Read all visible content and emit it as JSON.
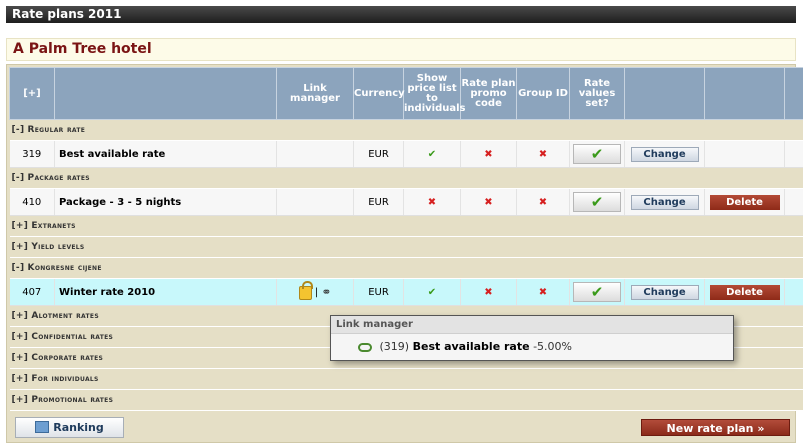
{
  "title": "Rate plans 2011",
  "hotel_name": "A Palm Tree hotel",
  "header": {
    "expand": "[+]",
    "link_manager": "Link manager",
    "currency": "Currency",
    "show_price": "Show price list to individuals",
    "promo_code": "Rate plan promo code",
    "group_id": "Group ID",
    "rate_values": "Rate values set?"
  },
  "groups": {
    "regular": {
      "toggle": "[-]",
      "label": "Regular rate"
    },
    "package": {
      "toggle": "[-]",
      "label": "Package rates"
    },
    "extranets": {
      "toggle": "[+]",
      "label": "Extranets"
    },
    "yield": {
      "toggle": "[+]",
      "label": "Yield levels"
    },
    "kongresne": {
      "toggle": "[-]",
      "label": "Kongresne cijene"
    },
    "alotment": {
      "toggle": "[+]",
      "label": "Alotment rates"
    },
    "confidential": {
      "toggle": "[+]",
      "label": "Confidential rates"
    },
    "corporate": {
      "toggle": "[+]",
      "label": "Corporate rates"
    },
    "individuals": {
      "toggle": "[+]",
      "label": "For individuals"
    },
    "promotional": {
      "toggle": "[+]",
      "label": "Promotional rates"
    }
  },
  "rates": {
    "r319": {
      "id": "319",
      "name": "Best available rate",
      "currency": "EUR",
      "show_price": "✔",
      "promo": "✖",
      "group": "✖",
      "values_set": "✔",
      "change": "Change"
    },
    "r410": {
      "id": "410",
      "name": "Package - 3 - 5 nights",
      "currency": "EUR",
      "show_price": "✖",
      "promo": "✖",
      "group": "✖",
      "values_set": "✔",
      "change": "Change",
      "delete": "Delete"
    },
    "r407": {
      "id": "407",
      "name": "Winter rate 2010",
      "link_sep": "|",
      "currency": "EUR",
      "show_price": "✔",
      "promo": "✖",
      "group": "✖",
      "values_set": "✔",
      "change": "Change",
      "delete": "Delete"
    }
  },
  "popup": {
    "title": "Link manager",
    "ref": "(319)",
    "name": "Best available rate",
    "value": "-5.00%"
  },
  "buttons": {
    "ranking": "Ranking",
    "new_rate_plan": "New rate plan »"
  }
}
